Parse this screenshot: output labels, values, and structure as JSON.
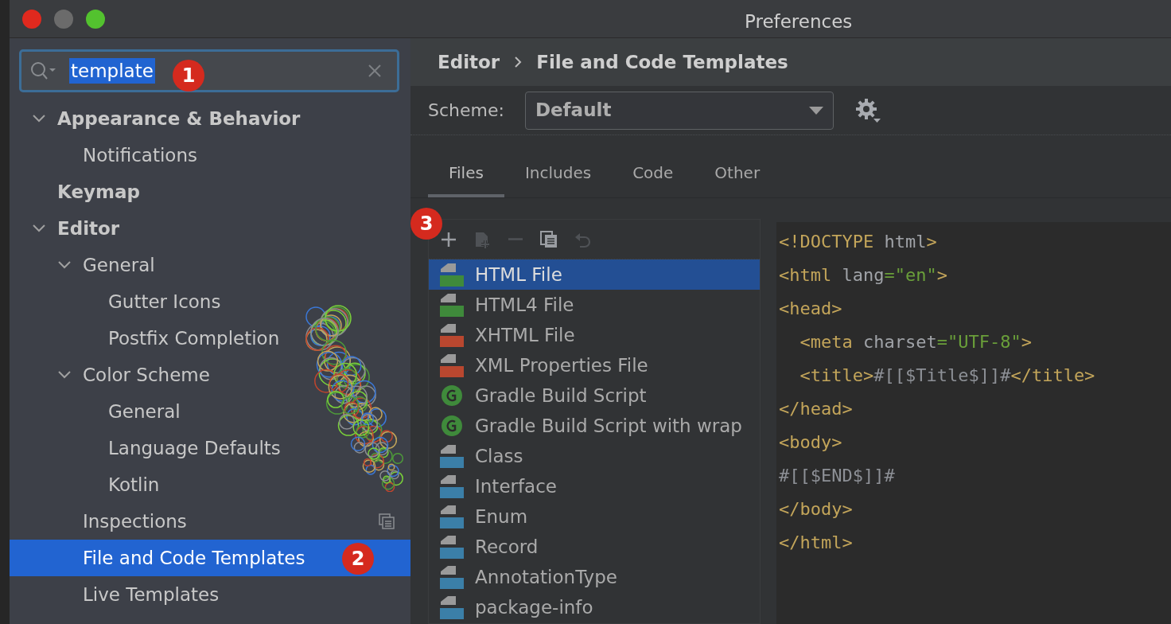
{
  "window": {
    "title": "Preferences"
  },
  "search": {
    "value": "template",
    "callout": "1"
  },
  "sidebar": {
    "items": [
      {
        "label": "Appearance & Behavior",
        "expanded": true,
        "selected": false,
        "children": [
          {
            "label": "Notifications",
            "selected": false
          }
        ]
      },
      {
        "label": "Keymap",
        "selected": false
      },
      {
        "label": "Editor",
        "expanded": true,
        "selected": false,
        "children": [
          {
            "label": "General",
            "expanded": true,
            "selected": false,
            "children": [
              {
                "label": "Gutter Icons",
                "selected": false
              },
              {
                "label": "Postfix Completion",
                "selected": false
              }
            ]
          },
          {
            "label": "Color Scheme",
            "expanded": true,
            "selected": false,
            "children": [
              {
                "label": "General",
                "selected": false
              },
              {
                "label": "Language Defaults",
                "selected": false
              },
              {
                "label": "Kotlin",
                "selected": false
              }
            ]
          },
          {
            "label": "Inspections",
            "selected": false,
            "copy_icon": true
          },
          {
            "label": "File and Code Templates",
            "selected": true,
            "callout": "2"
          },
          {
            "label": "Live Templates",
            "selected": false
          }
        ]
      }
    ]
  },
  "breadcrumb": [
    "Editor",
    "File and Code Templates"
  ],
  "scheme": {
    "label": "Scheme:",
    "value": "Default"
  },
  "tabs": [
    {
      "label": "Files",
      "selected": true
    },
    {
      "label": "Includes",
      "selected": false
    },
    {
      "label": "Code",
      "selected": false
    },
    {
      "label": "Other",
      "selected": false
    }
  ],
  "toolbar": {
    "callout": "3",
    "buttons": [
      {
        "kind": "add",
        "disabled": false
      },
      {
        "kind": "add-child",
        "disabled": true
      },
      {
        "kind": "remove",
        "disabled": true
      },
      {
        "kind": "copy",
        "disabled": false
      },
      {
        "kind": "reset",
        "disabled": true
      }
    ]
  },
  "templates": [
    {
      "name": "HTML File",
      "kind": "html",
      "selected": true
    },
    {
      "name": "HTML4 File",
      "kind": "html",
      "selected": false
    },
    {
      "name": "XHTML File",
      "kind": "xhtml",
      "selected": false
    },
    {
      "name": "XML Properties File",
      "kind": "xml",
      "selected": false
    },
    {
      "name": "Gradle Build Script",
      "kind": "gradle",
      "selected": false
    },
    {
      "name": "Gradle Build Script with wrap",
      "kind": "gradle",
      "selected": false
    },
    {
      "name": "Class",
      "kind": "java",
      "selected": false
    },
    {
      "name": "Interface",
      "kind": "java",
      "selected": false
    },
    {
      "name": "Enum",
      "kind": "java",
      "selected": false
    },
    {
      "name": "Record",
      "kind": "java",
      "selected": false
    },
    {
      "name": "AnnotationType",
      "kind": "java",
      "selected": false
    },
    {
      "name": "package-info",
      "kind": "java",
      "selected": false
    }
  ],
  "code": [
    [
      {
        "text": "<!DOCTYPE ",
        "kind": "tag"
      },
      {
        "text": "html",
        "kind": "attr"
      },
      {
        "text": ">",
        "kind": "tag"
      }
    ],
    [
      {
        "text": "<html ",
        "kind": "tag"
      },
      {
        "text": "lang",
        "kind": "attr"
      },
      {
        "text": "=\"en\"",
        "kind": "str"
      },
      {
        "text": ">",
        "kind": "tag"
      }
    ],
    [
      {
        "text": "<head>",
        "kind": "tag"
      }
    ],
    [
      {
        "text": "  <meta ",
        "kind": "tag"
      },
      {
        "text": "charset",
        "kind": "attr"
      },
      {
        "text": "=\"UTF-8\"",
        "kind": "str"
      },
      {
        "text": ">",
        "kind": "tag"
      }
    ],
    [
      {
        "text": "  <title>",
        "kind": "tag"
      },
      {
        "text": "#[[$Title$]]#",
        "kind": "var"
      },
      {
        "text": "</title>",
        "kind": "tag"
      }
    ],
    [
      {
        "text": "</head>",
        "kind": "tag"
      }
    ],
    [
      {
        "text": "<body>",
        "kind": "tag"
      }
    ],
    [
      {
        "text": "#[[$END$]]#",
        "kind": "var"
      }
    ],
    [
      {
        "text": "</body>",
        "kind": "tag"
      }
    ],
    [
      {
        "text": "</html>",
        "kind": "tag"
      }
    ]
  ]
}
